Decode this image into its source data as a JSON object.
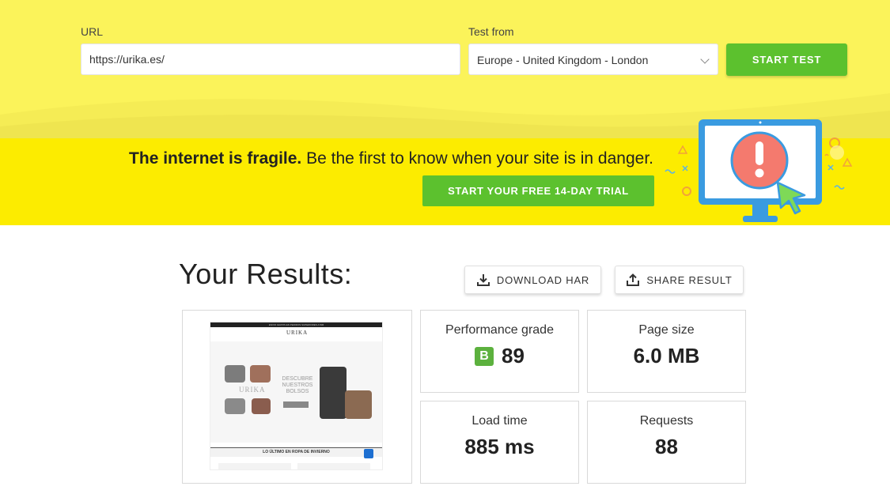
{
  "form": {
    "url_label": "URL",
    "url_value": "https://urika.es/",
    "test_from_label": "Test from",
    "test_from_value": "Europe - United Kingdom - London",
    "start_label": "START TEST"
  },
  "banner": {
    "headline_bold": "The internet is fragile.",
    "headline_rest": " Be the first to know when your site is in danger.",
    "cta_label": "START YOUR FREE 14-DAY TRIAL"
  },
  "results": {
    "title": "Your Results:",
    "download_label": "DOWNLOAD HAR",
    "share_label": "SHARE RESULT",
    "performance_grade_label": "Performance grade",
    "performance_grade_letter": "B",
    "performance_grade_value": "89",
    "page_size_label": "Page size",
    "page_size_value": "6.0 MB",
    "load_time_label": "Load time",
    "load_time_value": "885 ms",
    "requests_label": "Requests",
    "requests_value": "88"
  },
  "screenshot": {
    "topbar": "ENVIO GRATIS EN PEDIDOS SUPERIORES A 50€",
    "brand": "URIKA",
    "hero_title": "DESCUBRE NUESTROS BOLSOS",
    "strip": "LO ÚLTIMO EN ROPA DE INVIERNO"
  },
  "colors": {
    "top_bg": "#fbf35a",
    "banner_bg": "#fcec00",
    "accent_green": "#5cc12e",
    "grade_b": "#5cb13e"
  }
}
